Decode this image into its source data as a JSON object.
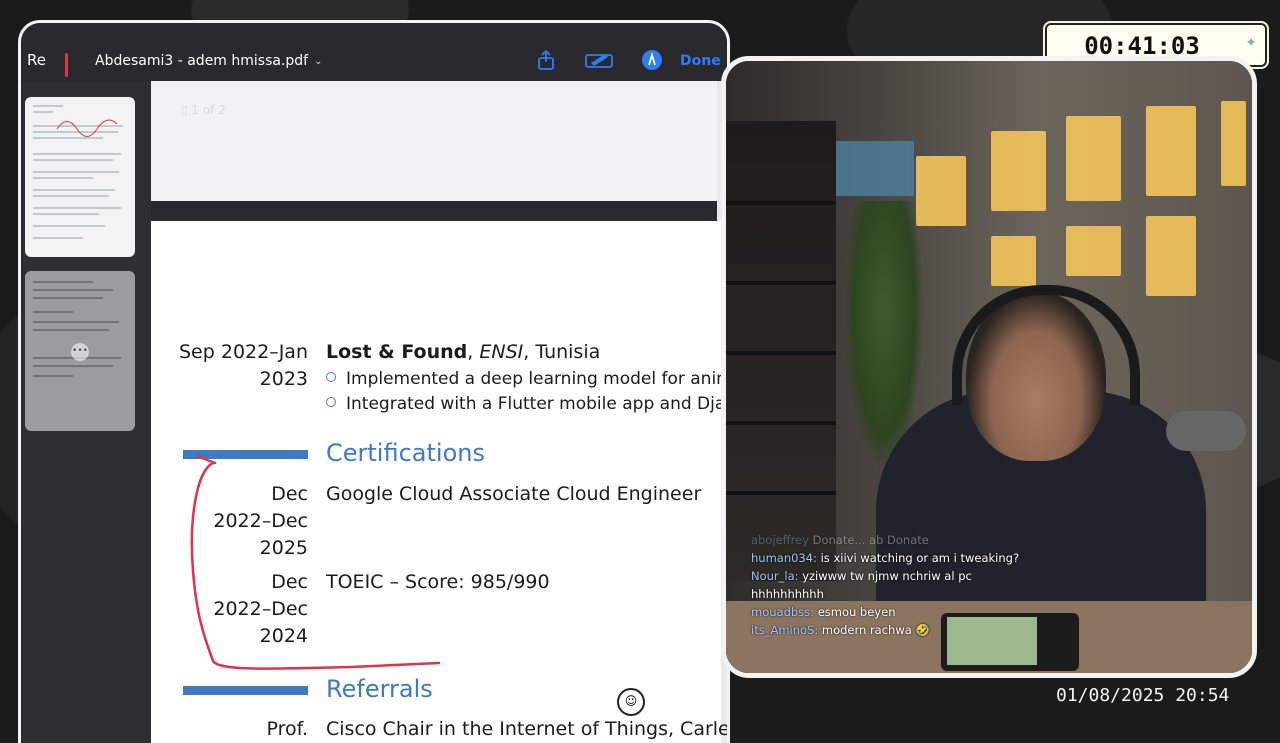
{
  "toolbar": {
    "back_label": "Re",
    "doc_title": "Abdesami3 - adem hmissa.pdf",
    "done_label": "Done",
    "share_icon": "share-icon",
    "markup_icon": "markup-icon",
    "pen_icon": "pen-circle-icon"
  },
  "document": {
    "entry1_dates_line1": "Sep 2022–Jan",
    "entry1_dates_line2": "2023",
    "entry1_title_bold": "Lost & Found",
    "entry1_title_italic": "ENSI",
    "entry1_title_rest": ", Tunisia",
    "entry1_bullet1": "Implemented a deep learning model for anim",
    "entry1_bullet2": "Integrated with a Flutter mobile app and Dja",
    "section_certifications": "Certifications",
    "cert1_dates_line1": "Dec",
    "cert1_dates_line2": "2022–Dec",
    "cert1_dates_line3": "2025",
    "cert1_name": "Google Cloud Associate Cloud Engineer",
    "cert2_dates_line1": "Dec",
    "cert2_dates_line2": "2022–Dec",
    "cert2_dates_line3": "2024",
    "cert2_name": "TOEIC – Score:  985/990",
    "section_referrals": "Referrals",
    "ref1_left": "Prof.",
    "ref1_text": "Cisco Chair in the Internet of Things, Carle"
  },
  "timer": {
    "value": "00:41:03"
  },
  "chat": [
    {
      "user": "abojeffrey",
      "message": "Donate...   ab Donate",
      "faded": true
    },
    {
      "user": "human034:",
      "message": "is xiivi watching or am i tweaking?",
      "faded": false
    },
    {
      "user": "Nour_la:",
      "message": "yziwww tw njmw nchriw al pc",
      "faded": false
    },
    {
      "user": "",
      "message": "hhhhhhhhhh",
      "faded": false
    },
    {
      "user": "mouadbss:",
      "message": "esmou beyen",
      "faded": false
    },
    {
      "user": "its_AminoS:",
      "message": "modern rachwa 🤣",
      "faded": false
    }
  ],
  "datetime": "01/08/2025 20:54",
  "colors": {
    "accent_blue": "#3f79c3",
    "ios_blue": "#2f7cf6",
    "ink_red": "#e0334a"
  }
}
